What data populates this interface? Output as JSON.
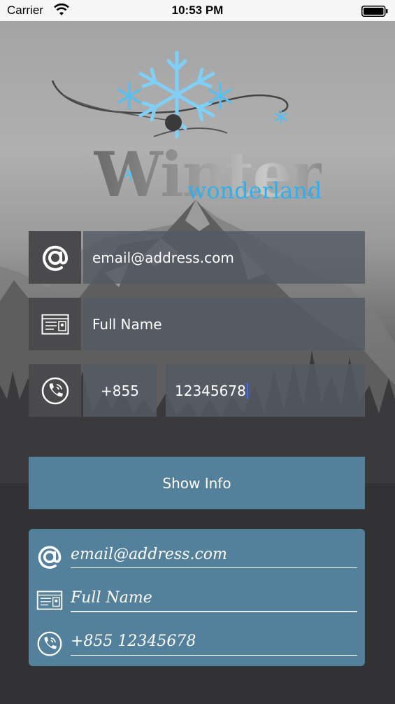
{
  "status_bar": {
    "carrier": "Carrier",
    "time": "10:53 PM"
  },
  "logo": {
    "title": "Winter",
    "subtitle": "wonderland"
  },
  "form": {
    "email_value": "email@address.com",
    "name_value": "Full Name",
    "country_code": "+855",
    "phone_value": "12345678"
  },
  "button": {
    "label": "Show Info"
  },
  "info_card": {
    "email": "email@address.com",
    "name": "Full Name",
    "phone": "+855 12345678"
  },
  "colors": {
    "accent": "#53809b",
    "icon_box": "#4a4a4d",
    "background": "#323234",
    "logo_blue": "#2fb0ee"
  },
  "icons": [
    "wifi-icon",
    "battery-icon",
    "at-icon",
    "id-card-icon",
    "phone-icon",
    "snowflake-icon"
  ]
}
